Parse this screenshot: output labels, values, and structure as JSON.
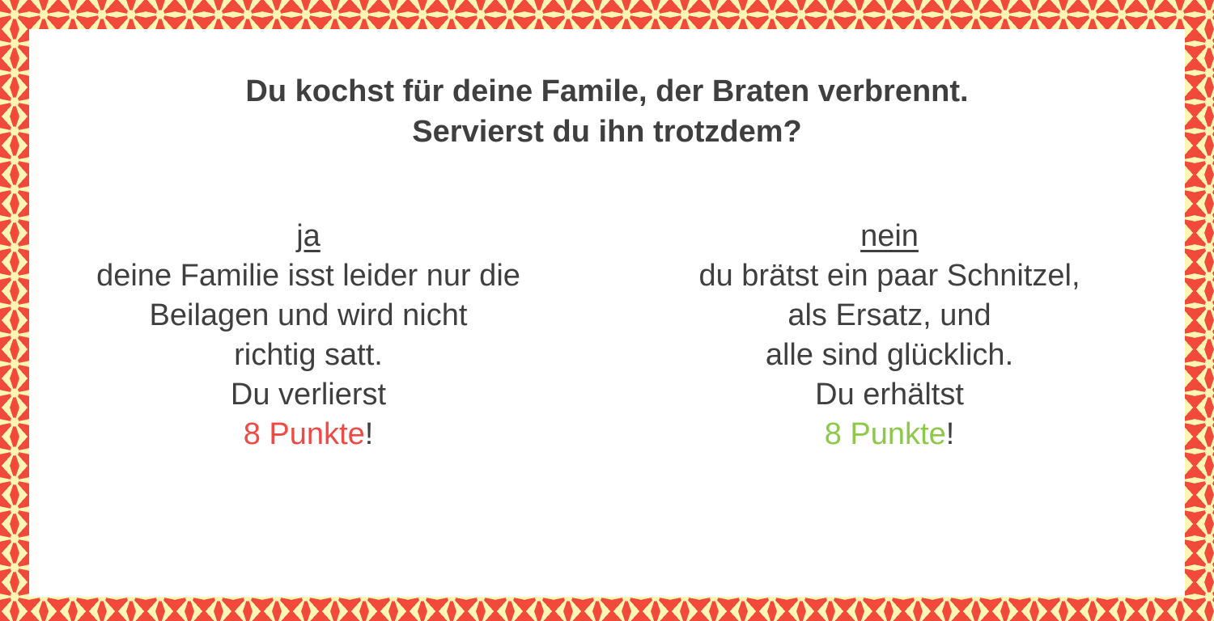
{
  "question": {
    "line1": "Du kochst für deine Famile, der Braten verbrennt.",
    "line2": "Servierst du ihn trotzdem?"
  },
  "options": [
    {
      "label": "ja",
      "lines": [
        "deine Familie isst leider nur die",
        "Beilagen und wird nicht",
        "richtig satt.",
        "Du verlierst"
      ],
      "points_text": "8 Punkte",
      "points_suffix": "!",
      "points_color": "#ef4a45"
    },
    {
      "label": "nein",
      "lines": [
        "du brätst ein paar Schnitzel,",
        "als Ersatz, und",
        "alle sind glücklich.",
        "Du erhältst"
      ],
      "points_text": "8 Punkte",
      "points_suffix": "!",
      "points_color": "#8dc84a"
    }
  ],
  "colors": {
    "border_primary": "#f24a3a",
    "border_secondary": "#fff6b6",
    "text": "#3f3f3f"
  }
}
